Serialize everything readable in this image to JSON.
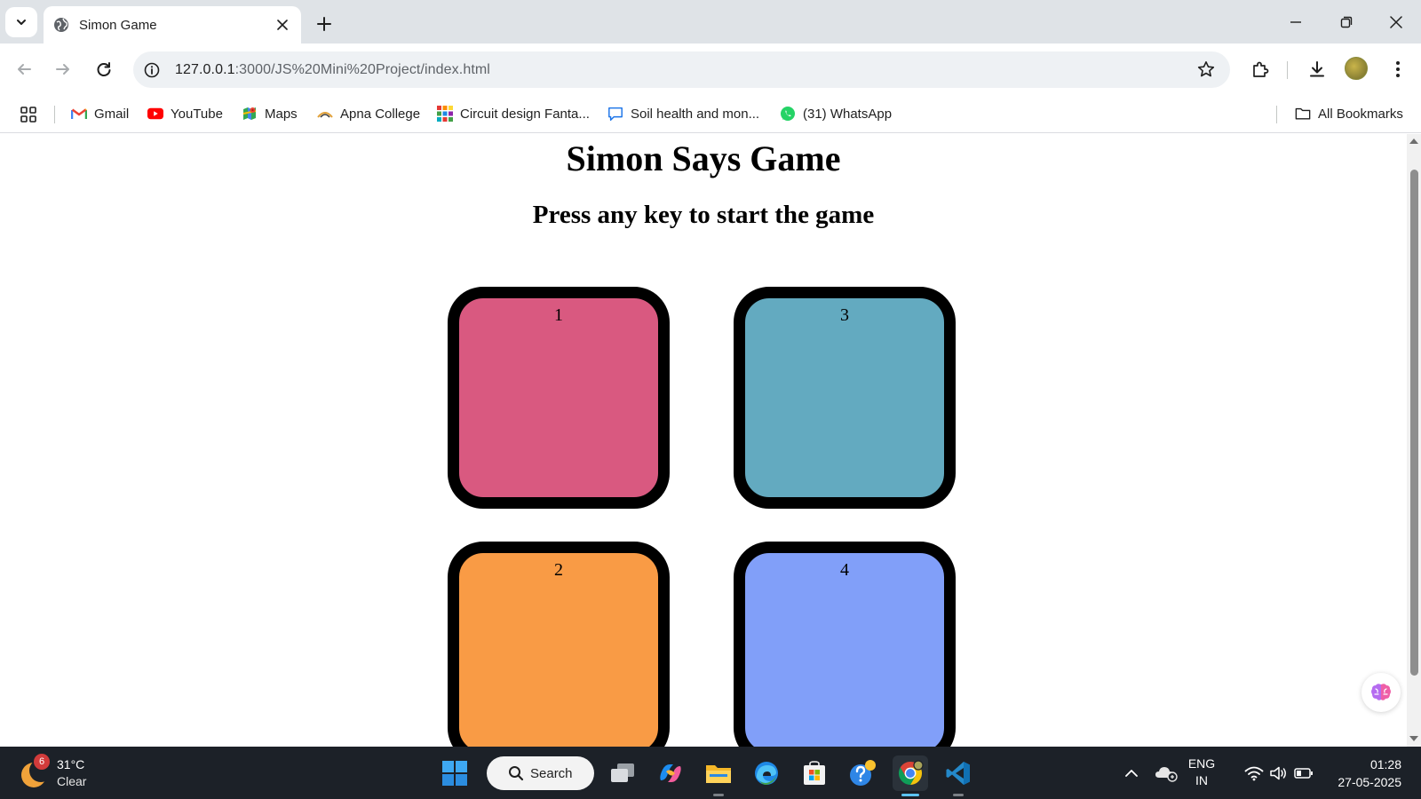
{
  "browser": {
    "tab": {
      "title": "Simon Game"
    },
    "url": {
      "host": "127.0.0.1",
      "path": ":3000/JS%20Mini%20Project/index.html"
    },
    "bookmarks": [
      {
        "label": "Gmail",
        "icon": "gmail-icon"
      },
      {
        "label": "YouTube",
        "icon": "youtube-icon"
      },
      {
        "label": "Maps",
        "icon": "maps-icon"
      },
      {
        "label": "Apna College",
        "icon": "apna-college-icon"
      },
      {
        "label": "Circuit design Fanta...",
        "icon": "circuit-design-icon"
      },
      {
        "label": "Soil health and mon...",
        "icon": "comment-icon"
      },
      {
        "label": "(31) WhatsApp",
        "icon": "whatsapp-icon"
      }
    ],
    "all_bookmarks": "All Bookmarks"
  },
  "page": {
    "title": "Simon Says Game",
    "subtitle": "Press any key to start the game",
    "buttons": [
      {
        "label": "1",
        "color": "#d95980"
      },
      {
        "label": "2",
        "color": "#f99b45"
      },
      {
        "label": "3",
        "color": "#63aac0"
      },
      {
        "label": "4",
        "color": "#819ff9"
      }
    ]
  },
  "taskbar": {
    "weather": {
      "badge": "6",
      "temp": "31°C",
      "condition": "Clear"
    },
    "search_label": "Search",
    "language": {
      "line1": "ENG",
      "line2": "IN"
    },
    "clock": {
      "time": "01:28",
      "date": "27-05-2025"
    }
  }
}
